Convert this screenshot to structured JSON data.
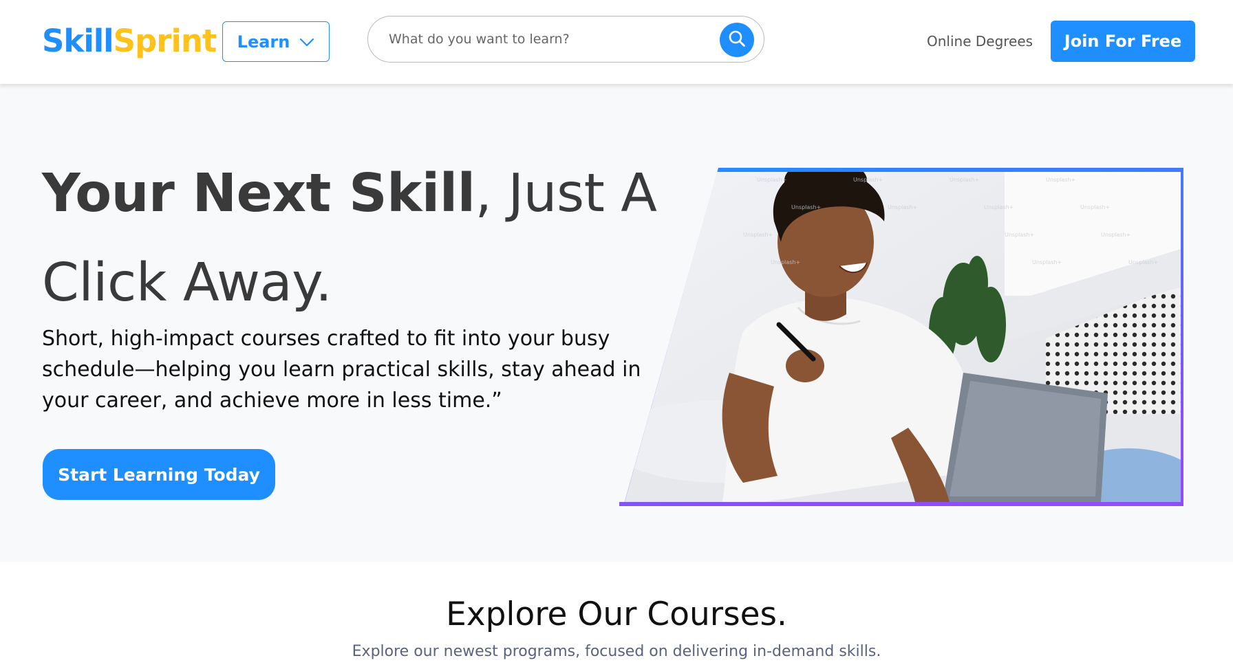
{
  "header": {
    "logo_part1": "Skill",
    "logo_part2": "Sprint",
    "learn_label": "Learn",
    "search_placeholder": "What do you want to learn?",
    "online_degrees": "Online Degrees",
    "join_label": "Join For Free"
  },
  "hero": {
    "title_bold": "Your Next Skill",
    "title_rest": ", Just A Click Away.",
    "description": "Short, high-impact courses crafted to fit into your busy schedule—helping you learn practical skills, stay ahead in your career, and achieve more in less time.”",
    "cta_label": "Start Learning Today",
    "image_alt": "Student smiling at laptop holding a pen"
  },
  "courses": {
    "title": "Explore Our Courses.",
    "subtitle": "Explore our newest programs, focused on delivering in-demand skills."
  },
  "colors": {
    "brand_blue": "#1f8fff",
    "brand_yellow": "#ffc21a",
    "frame_gradient_start": "#1f8fff",
    "frame_gradient_end": "#8f4dfb",
    "hero_bg": "#f8f9fb"
  },
  "icons": {
    "learn_chevron": "chevron-down-icon",
    "search": "search-icon"
  }
}
